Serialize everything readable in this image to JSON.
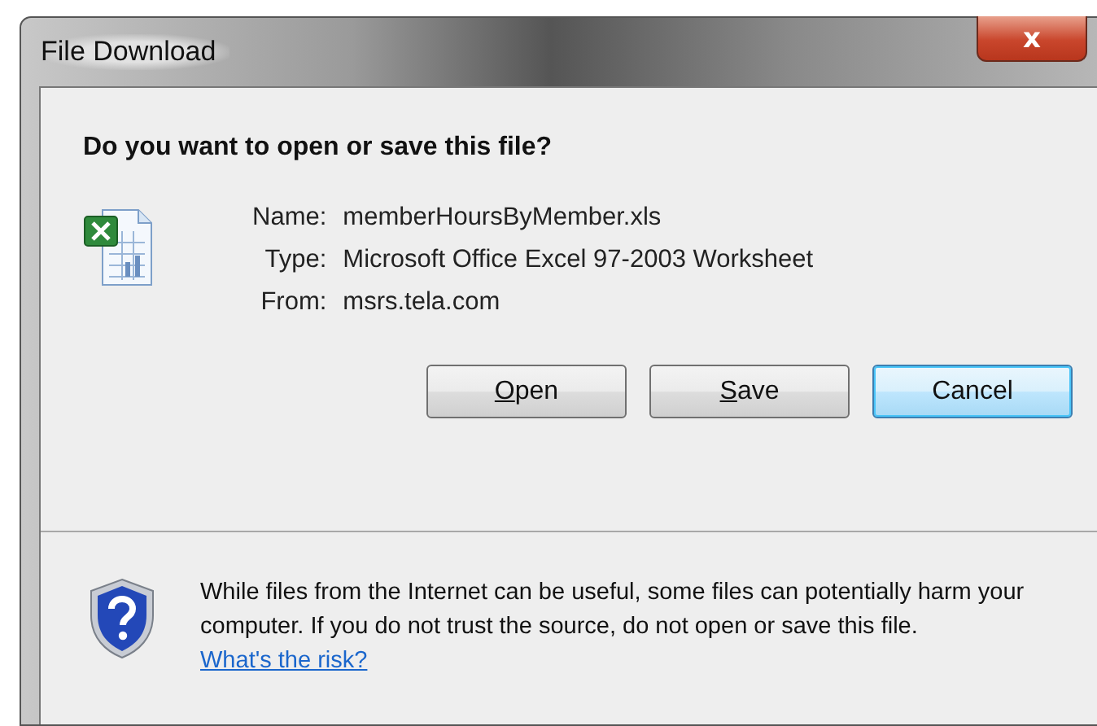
{
  "window": {
    "title": "File Download",
    "close_label": "x"
  },
  "heading": "Do you want to open or save this file?",
  "file_info": [
    {
      "label": "Name:",
      "value": "memberHoursByMember.xls"
    },
    {
      "label": "Type:",
      "value": "Microsoft Office Excel 97-2003 Worksheet"
    },
    {
      "label": "From:",
      "value": "msrs.tela.com"
    }
  ],
  "buttons": [
    {
      "label": "Open",
      "first_letter_underlined": true,
      "default": false
    },
    {
      "label": "Save",
      "first_letter_underlined": true,
      "default": false
    },
    {
      "label": "Cancel",
      "first_letter_underlined": false,
      "default": true
    }
  ],
  "warning": {
    "text": "While files from the Internet can be useful, some files can potentially harm your computer. If you do not trust the source, do not open or save this file.",
    "link": "What's the risk?"
  }
}
